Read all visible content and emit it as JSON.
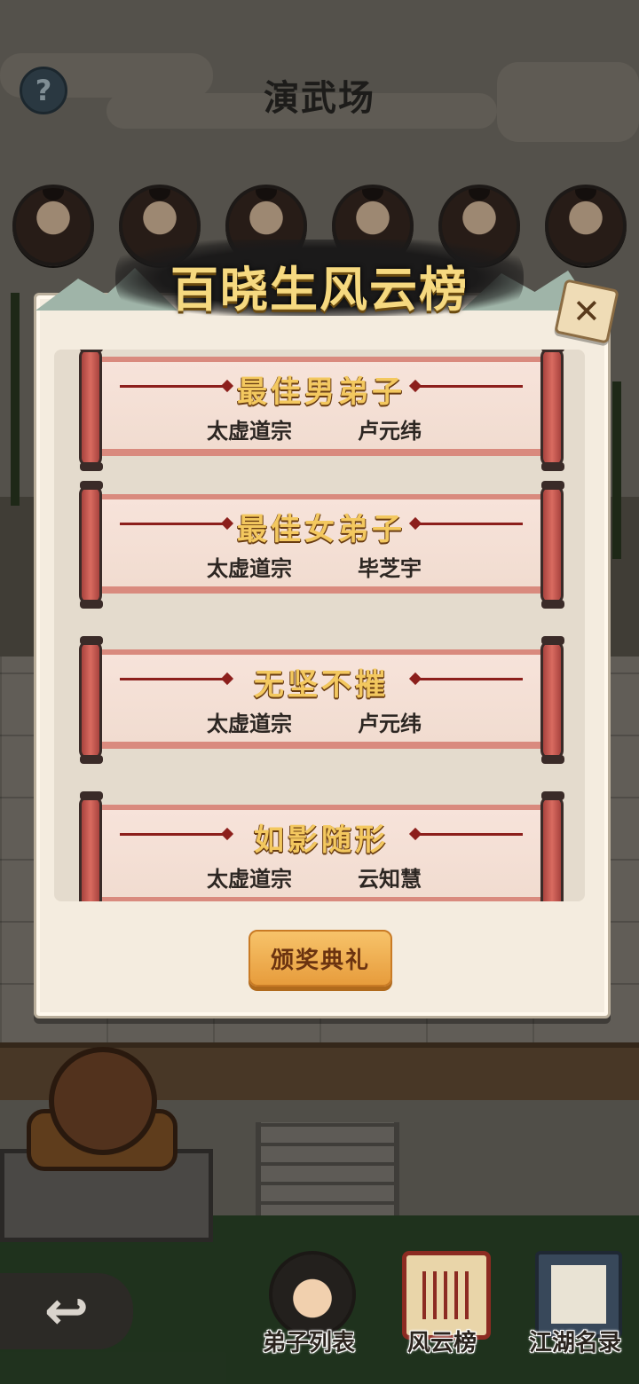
{
  "header": {
    "title": "演武场",
    "help_icon": "question-mark-icon",
    "help_glyph": "?"
  },
  "avatars": [
    {
      "icon": "disciple-avatar-1"
    },
    {
      "icon": "disciple-avatar-2"
    },
    {
      "icon": "disciple-avatar-3"
    },
    {
      "icon": "disciple-avatar-4"
    },
    {
      "icon": "disciple-avatar-5"
    },
    {
      "icon": "disciple-avatar-6"
    }
  ],
  "modal": {
    "title": "百晓生风云榜",
    "close_glyph": "✕",
    "awards": [
      {
        "title": "最佳男弟子",
        "sect": "太虚道宗",
        "name": "卢元纬"
      },
      {
        "title": "最佳女弟子",
        "sect": "太虚道宗",
        "name": "毕芝宇"
      },
      {
        "title": "无坚不摧",
        "sect": "太虚道宗",
        "name": "卢元纬"
      },
      {
        "title": "如影随形",
        "sect": "太虚道宗",
        "name": "云知慧"
      }
    ],
    "ceremony_button": "颁奖典礼"
  },
  "nav": {
    "back_glyph": "↩",
    "items": [
      {
        "label": "弟子列表",
        "icon": "disciple-icon"
      },
      {
        "label": "风云榜",
        "icon": "scroll-icon"
      },
      {
        "label": "江湖名录",
        "icon": "book-icon"
      }
    ]
  },
  "colors": {
    "award_title": "#f3c85f",
    "banner_title": "#f6d980",
    "button": "#e79c3c",
    "scroll_rod": "#d96b60"
  }
}
